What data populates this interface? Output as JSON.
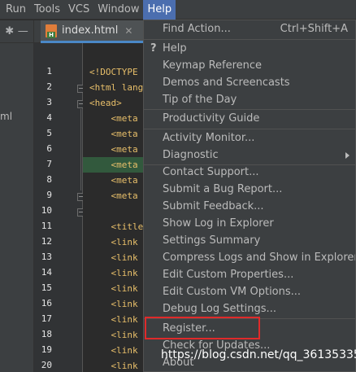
{
  "menubar": {
    "items": [
      "Run",
      "Tools",
      "VCS",
      "Window",
      "Help"
    ]
  },
  "left_panel": {
    "fragment": "ml"
  },
  "editor_tab": {
    "label": "index.html",
    "close": "✕"
  },
  "gutter": {
    "line_numbers": [
      "1",
      "2",
      "3",
      "4",
      "5",
      "6",
      "7",
      "8",
      "9",
      "10",
      "11",
      "12",
      "13",
      "14",
      "15",
      "16",
      "17",
      "18",
      "19",
      "20"
    ]
  },
  "code_lines": [
    "<!DOCTYPE h",
    "<html lang=",
    "<head>",
    "    <meta c",
    "    <meta c",
    "    <meta h",
    "    <meta n",
    "    <meta n",
    "    <meta n",
    "          c",
    "    <title>",
    "    <link r",
    "    <link r",
    "    <link r",
    "    <link r",
    "    <link r",
    "    <link r",
    "    <link r",
    "    <link r",
    "    <link r"
  ],
  "help_menu": {
    "items": [
      {
        "label": "Find Action...",
        "shortcut": "Ctrl+Shift+A"
      },
      {
        "label": "Help",
        "icon": "question-icon"
      },
      {
        "label": "Keymap Reference"
      },
      {
        "label": "Demos and Screencasts"
      },
      {
        "label": "Tip of the Day"
      },
      {
        "label": "Productivity Guide"
      },
      {
        "label": "Activity Monitor..."
      },
      {
        "label": "Diagnostic",
        "submenu": true
      },
      {
        "label": "Contact Support..."
      },
      {
        "label": "Submit a Bug Report..."
      },
      {
        "label": "Submit Feedback..."
      },
      {
        "label": "Show Log in Explorer"
      },
      {
        "label": "Settings Summary"
      },
      {
        "label": "Compress Logs and Show in Explorer"
      },
      {
        "label": "Edit Custom Properties..."
      },
      {
        "label": "Edit Custom VM Options..."
      },
      {
        "label": "Debug Log Settings..."
      },
      {
        "label": "Register..."
      },
      {
        "label": "Check for Updates..."
      },
      {
        "label": "About"
      }
    ]
  },
  "watermark": "https://blog.csdn.net/qq_36135335",
  "colors": {
    "accent": "#4b6eaf",
    "highlight_box": "#e02a2a",
    "menu_bg": "#3c3f41"
  }
}
